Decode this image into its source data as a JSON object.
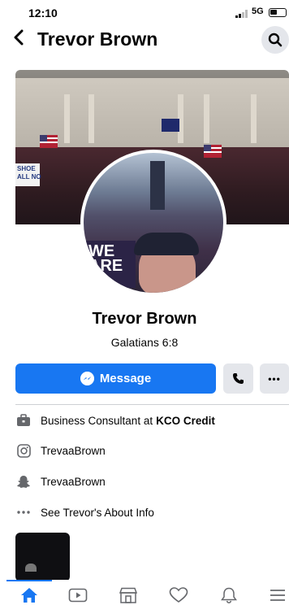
{
  "status_bar": {
    "time": "12:10",
    "network": "5G"
  },
  "nav": {
    "title": "Trevor Brown"
  },
  "cover": {
    "sign_text": "SHOE\nALL NO"
  },
  "avatar": {
    "board_text": "WE\nARE"
  },
  "profile": {
    "name": "Trevor Brown",
    "bio": "Galatians 6:8"
  },
  "actions": {
    "message_label": "Message",
    "more_label": "•••"
  },
  "info": [
    {
      "icon": "briefcase-icon",
      "prefix": "Business Consultant at",
      "emphasis": "KCO Credit"
    },
    {
      "icon": "instagram-icon",
      "text": "TrevaaBrown"
    },
    {
      "icon": "snapchat-icon",
      "text": "TrevaaBrown"
    },
    {
      "icon": "more-dots-icon",
      "text": "See Trevor's About Info"
    }
  ],
  "tabs": [
    {
      "name": "home-icon",
      "active": true
    },
    {
      "name": "video-icon",
      "active": false
    },
    {
      "name": "marketplace-icon",
      "active": false
    },
    {
      "name": "dating-heart-icon",
      "active": false
    },
    {
      "name": "notifications-bell-icon",
      "active": false
    },
    {
      "name": "menu-icon",
      "active": false
    }
  ],
  "colors": {
    "accent": "#1877f2",
    "button_gray": "#e4e6eb",
    "text": "#050505",
    "secondary": "#65676b"
  }
}
